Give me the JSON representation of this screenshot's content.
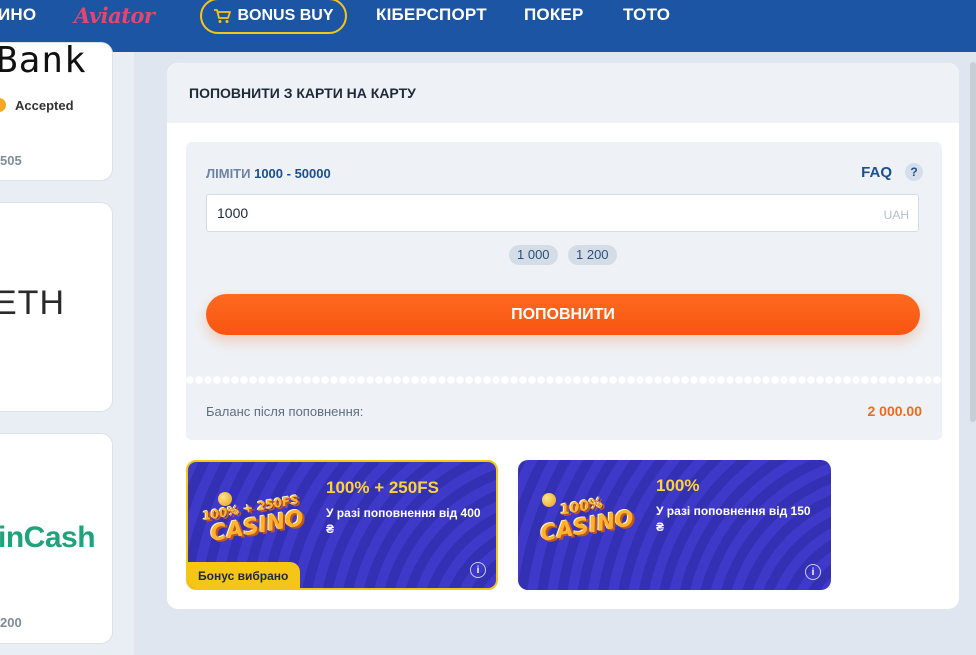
{
  "nav": {
    "casino_partial": "ИНО",
    "aviator": "Aviator",
    "bonus_buy": "BONUS BUY",
    "esports": "КІБЕРСПОРТ",
    "poker": "ПОКЕР",
    "toto": "ТОТО"
  },
  "left": {
    "card1_logo": "Bank",
    "card1_status": "Accepted",
    "card1_number": "505",
    "card2_logo": "ETH",
    "card3_logo": "inCash",
    "card3_number": "200"
  },
  "panel": {
    "title": "ПОПОВНИТИ З КАРТИ НА КАРТУ",
    "limits_label": "ЛІМІТИ",
    "limits_value": "1000 - 50000",
    "faq": "FAQ",
    "help": "?",
    "amount_value": "1000",
    "currency": "UAH",
    "chips": [
      "1 000",
      "1 200"
    ],
    "submit": "ПОПОВНИТИ",
    "balance_label": "Баланс після поповнення:",
    "balance_value": "2 000.00"
  },
  "bonuses": [
    {
      "logo_top": "100% + 250FS",
      "logo_bottom": "CASINO",
      "title": "100% + 250FS",
      "desc": "У разі поповнення від 400 ₴",
      "badge": "Бонус вибрано",
      "info": "i"
    },
    {
      "logo_top": "100%",
      "logo_bottom": "CASINO",
      "title": "100%",
      "desc": "У разі поповнення від 150 ₴",
      "info": "i"
    }
  ],
  "colors": {
    "nav_bg": "#1b55a3",
    "accent_orange": "#f85510",
    "bonus_gold": "#f5c518",
    "bonus_purple": "#3a36c2"
  }
}
